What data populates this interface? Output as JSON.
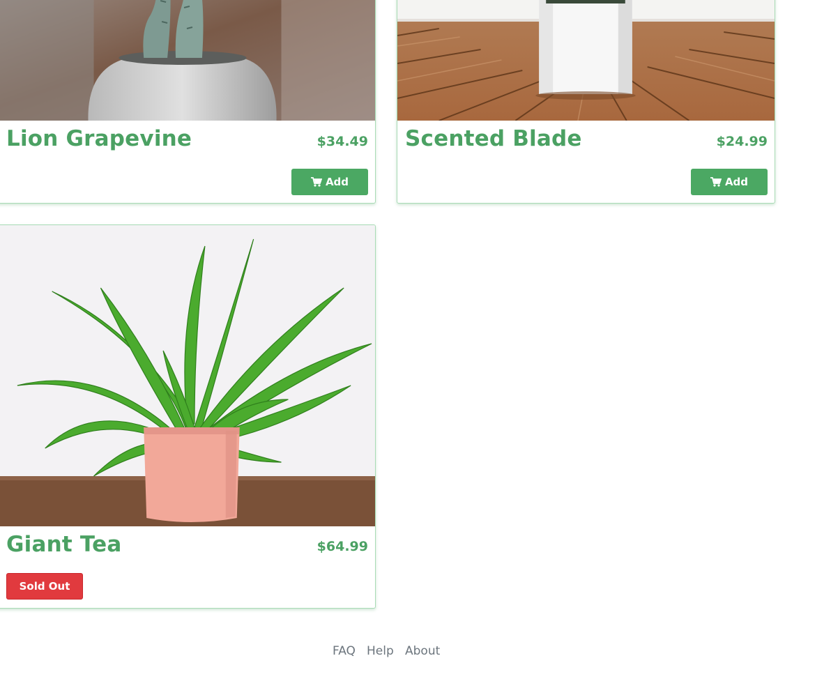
{
  "products": [
    {
      "name": "Lion Grapevine",
      "price": "$34.49",
      "action_label": "Add",
      "status": "available",
      "image_icon": "cactus-in-round-pot-image"
    },
    {
      "name": "Scented Blade",
      "price": "$24.99",
      "action_label": "Add",
      "status": "available",
      "image_icon": "white-square-pot-on-wood-floor-image"
    },
    {
      "name": "Giant Tea",
      "price": "$64.99",
      "action_label": "Sold Out",
      "status": "sold-out",
      "image_icon": "fern-in-pink-pot-image"
    }
  ],
  "footer": {
    "links": [
      "FAQ",
      "Help",
      "About"
    ]
  },
  "colors": {
    "brand_green": "#4ba163",
    "add_button": "#4ba863",
    "sold_out_button": "#e13a3e",
    "card_border": "#a8dbb5",
    "footer_link": "#6c757d"
  },
  "icons": {
    "add_button_icon": "shopping-cart-icon"
  }
}
